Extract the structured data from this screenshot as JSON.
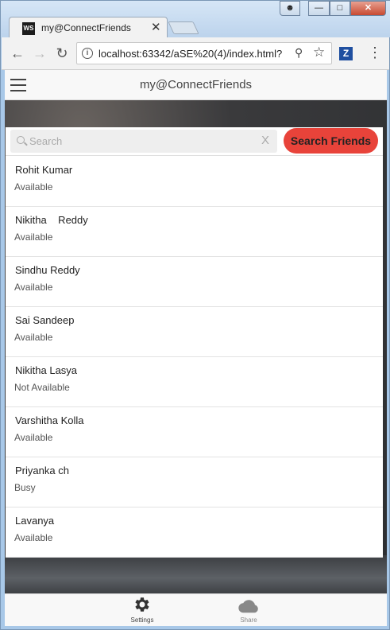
{
  "browser": {
    "tab_title": "my@ConnectFriends",
    "tab_icon_text": "WS",
    "url": "localhost:63342/aSE%20(4)/index.html?",
    "extension_label": "Z"
  },
  "app": {
    "title": "my@ConnectFriends",
    "search": {
      "placeholder": "Search",
      "value": "",
      "clear_label": "X",
      "button_label": "Search Friends",
      "button_color": "#e8433a"
    },
    "friends": [
      {
        "name": "Rohit Kumar",
        "status": "Available"
      },
      {
        "name": "Nikitha    Reddy",
        "status": "Available"
      },
      {
        "name": "Sindhu Reddy",
        "status": "Available"
      },
      {
        "name": "Sai Sandeep",
        "status": "Available"
      },
      {
        "name": "Nikitha Lasya",
        "status": "Not Available"
      },
      {
        "name": "Varshitha Kolla",
        "status": "Available"
      },
      {
        "name": "Priyanka ch",
        "status": "Busy"
      },
      {
        "name": "Lavanya",
        "status": "Available"
      }
    ],
    "bottom_tabs": [
      {
        "label": "Settings",
        "icon": "gear-icon",
        "active": true
      },
      {
        "label": "Share",
        "icon": "cloud-icon",
        "active": false
      }
    ]
  }
}
